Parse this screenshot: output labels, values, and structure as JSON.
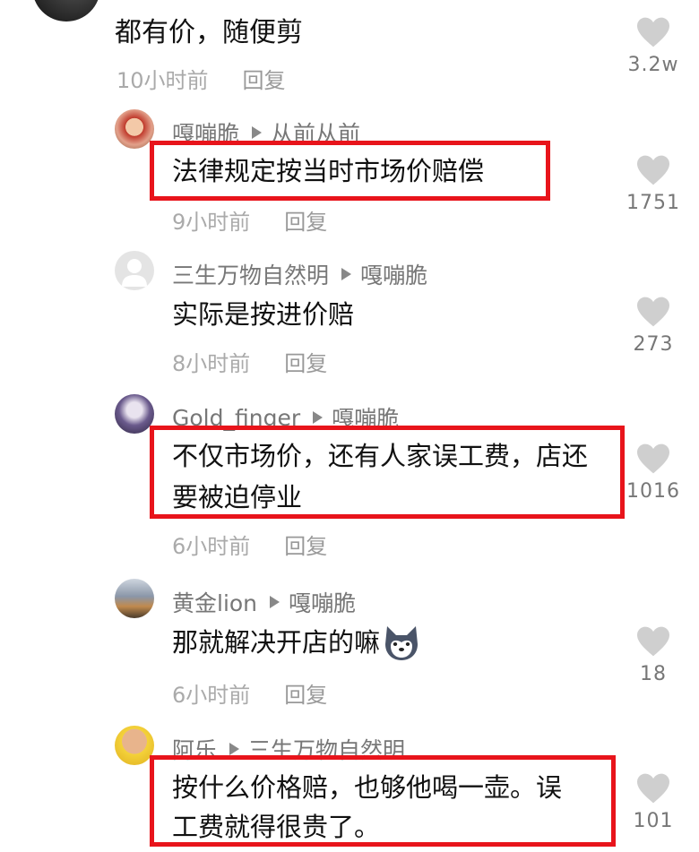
{
  "comments": [
    {
      "text": "都有价，随便剪",
      "time": "10小时前",
      "reply": "回复",
      "likes": "3.2w"
    },
    {
      "user": "嘎嘣脆",
      "reply_to": "从前从前",
      "text": "法律规定按当时市场价赔偿",
      "time": "9小时前",
      "reply": "回复",
      "likes": "1751"
    },
    {
      "user": "三生万物自然明",
      "reply_to": "嘎嘣脆",
      "text": "实际是按进价赔",
      "time": "8小时前",
      "reply": "回复",
      "likes": "273"
    },
    {
      "user": "Gold_finger",
      "reply_to": "嘎嘣脆",
      "text_line1": "不仅市场价，还有人家误工费，店还",
      "text_line2": "要被迫停业",
      "time": "6小时前",
      "reply": "回复",
      "likes": "1016"
    },
    {
      "user": "黄金lion",
      "reply_to": "嘎嘣脆",
      "text": "那就解决开店的嘛",
      "time": "6小时前",
      "reply": "回复",
      "likes": "18"
    },
    {
      "user": "阿乐",
      "reply_to": "三生万物自然明",
      "text_line1": "按什么价格赔，也够他喝一壶。误",
      "text_line2": "工费就得很贵了。",
      "likes": "101"
    }
  ],
  "icons": {
    "like": "heart-icon",
    "emoji": "husky-emoji-icon",
    "reply_arrow": "triangle-arrow-icon"
  },
  "colors": {
    "highlight": "#e8141b",
    "like_icon": "#cccccc",
    "meta_text": "#aaaaaa"
  }
}
